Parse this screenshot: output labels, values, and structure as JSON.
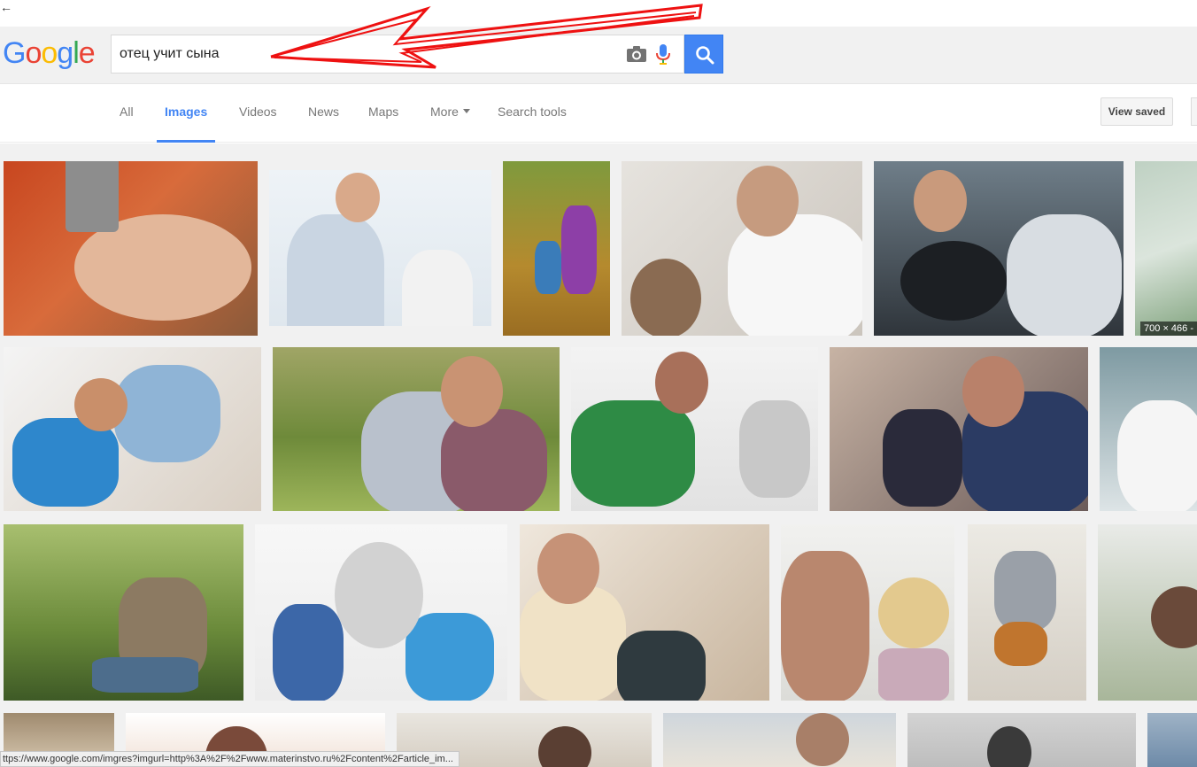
{
  "search": {
    "query": "отец учит сына"
  },
  "logo": {
    "text": "Google"
  },
  "tabs": [
    {
      "label": "All"
    },
    {
      "label": "Images"
    },
    {
      "label": "Videos"
    },
    {
      "label": "News"
    },
    {
      "label": "Maps"
    },
    {
      "label": "More"
    },
    {
      "label": "Search tools"
    }
  ],
  "toolbar": {
    "view_saved_label": "View saved"
  },
  "images": {
    "hover_dimensions": "700 × 466 -"
  },
  "status_bar": {
    "url": "ttps://www.google.com/imgres?imgurl=http%3A%2F%2Fwww.materinstvo.ru%2Fcontent%2Farticle_im..."
  },
  "colors": {
    "accent": "#4285f4",
    "annotation_arrow": "#ee1111"
  },
  "icons": [
    "back-arrow-icon",
    "camera-icon",
    "microphone-icon",
    "search-icon",
    "dropdown-caret-icon"
  ]
}
